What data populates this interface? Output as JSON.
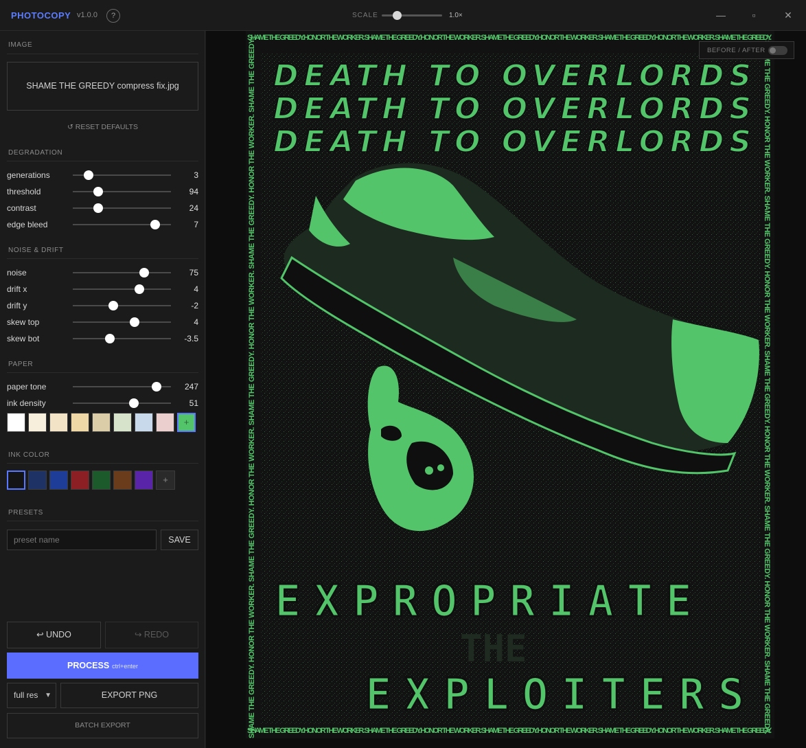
{
  "app": {
    "name": "PHOTOCOPY",
    "version": "v1.0.0",
    "help": "?"
  },
  "scale": {
    "label": "SCALE",
    "value": "1.0×",
    "level": 0.25
  },
  "window_controls": {
    "minimize": "—",
    "maximize": "▫",
    "close": "✕"
  },
  "image": {
    "section": "IMAGE",
    "filename": "SHAME THE GREEDY compress fix.jpg",
    "reset_label": "↺ RESET DEFAULTS"
  },
  "degradation": {
    "section": "DEGRADATION",
    "sliders": [
      {
        "label": "generations",
        "value": "3",
        "level": 0.16
      },
      {
        "label": "threshold",
        "value": "94",
        "level": 0.26
      },
      {
        "label": "contrast",
        "value": "24",
        "level": 0.26
      },
      {
        "label": "edge bleed",
        "value": "7",
        "level": 0.84
      }
    ]
  },
  "noise_drift": {
    "section": "NOISE & DRIFT",
    "sliders": [
      {
        "label": "noise",
        "value": "75",
        "level": 0.73
      },
      {
        "label": "drift x",
        "value": "4",
        "level": 0.68
      },
      {
        "label": "drift y",
        "value": "-2",
        "level": 0.41
      },
      {
        "label": "skew top",
        "value": "4",
        "level": 0.63
      },
      {
        "label": "skew bot",
        "value": "-3.5",
        "level": 0.38
      }
    ]
  },
  "paper": {
    "section": "PAPER",
    "sliders": [
      {
        "label": "paper tone",
        "value": "247",
        "level": 0.85
      },
      {
        "label": "ink density",
        "value": "51",
        "level": 0.62
      }
    ],
    "swatches": [
      "#ffffff",
      "#f7efdc",
      "#f3e3c6",
      "#efd7a6",
      "#dccda9",
      "#d8e3cc",
      "#c9d9ec",
      "#ebcfcf",
      "#53c46a"
    ],
    "selected_index": 8,
    "selected_symbol": "+"
  },
  "ink": {
    "section": "INK COLOR",
    "swatches": [
      "#141414",
      "#1f3266",
      "#1e3d99",
      "#8c1f24",
      "#1c5a2c",
      "#6a3c1c",
      "#5a24a8"
    ],
    "selected_index": 0,
    "add_label": "+"
  },
  "presets": {
    "section": "PRESETS",
    "placeholder": "preset name",
    "value": "",
    "save_label": "SAVE"
  },
  "actions": {
    "undo": "↩ UNDO",
    "redo": "↪ REDO",
    "process": "PROCESS",
    "process_hint": "ctrl+enter",
    "resolution": "full res",
    "export": "EXPORT PNG",
    "batch": "BATCH EXPORT"
  },
  "preview": {
    "toggle_label": "BEFORE / AFTER",
    "toggle_on": false,
    "border_text": "SHAME THE GREEDY. HONOR THE WORKER. SHAME THE GREEDY. HONOR THE WORKER. SHAME THE GREEDY. HONOR THE WORKER. SHAME THE GREEDY. HONOR THE WORKER. SHAME THE GREEDY.",
    "top_lettering": "DEATH TO OVERLORDS",
    "bottom_lettering_1": "EXPROPRIATE",
    "bottom_lettering_2": "THE",
    "bottom_lettering_3": "EXPLOITERS",
    "ink_color": "#53c46a",
    "paper_color": "#141414"
  }
}
